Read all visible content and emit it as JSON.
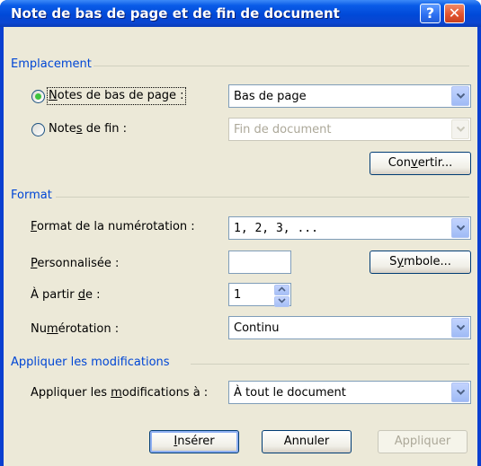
{
  "window": {
    "title": "Note de bas de page et de fin de document",
    "help_glyph": "?",
    "close_glyph": "✕"
  },
  "placement": {
    "group_label": "Emplacement",
    "footnotes": {
      "prefix": "",
      "underlined": "N",
      "suffix": "otes de bas de page :",
      "selected": true,
      "value": "Bas de page"
    },
    "endnotes": {
      "prefix": "Note",
      "underlined": "s",
      "suffix": " de fin :",
      "selected": false,
      "value": "Fin de document",
      "disabled": true
    },
    "convert_button": {
      "prefix": "Con",
      "underlined": "v",
      "suffix": "ertir..."
    }
  },
  "format": {
    "group_label": "Format",
    "number_format": {
      "prefix": "",
      "underlined": "F",
      "suffix": "ormat de la numérotation :",
      "value": "1, 2, 3, ..."
    },
    "custom_mark": {
      "prefix": "",
      "underlined": "P",
      "suffix": "ersonnalisée :",
      "value": ""
    },
    "symbol_button": {
      "prefix": "S",
      "underlined": "y",
      "suffix": "mbole..."
    },
    "start_at": {
      "prefix": "À partir ",
      "underlined": "d",
      "suffix": "e :",
      "value": "1"
    },
    "numbering": {
      "prefix": "Nu",
      "underlined": "m",
      "suffix": "érotation :",
      "value": "Continu"
    }
  },
  "apply": {
    "group_label": "Appliquer les modifications",
    "apply_to": {
      "prefix": "Appliquer les ",
      "underlined": "m",
      "suffix": "odifications à :",
      "value": "À tout le document"
    }
  },
  "buttons": {
    "insert": {
      "prefix": "",
      "underlined": "I",
      "suffix": "nsérer"
    },
    "cancel": "Annuler",
    "apply": "Appliquer"
  },
  "icons": {
    "dropdown_arrow": "chevron-down-icon",
    "spin_up": "spin-up-icon",
    "spin_down": "spin-down-icon"
  }
}
